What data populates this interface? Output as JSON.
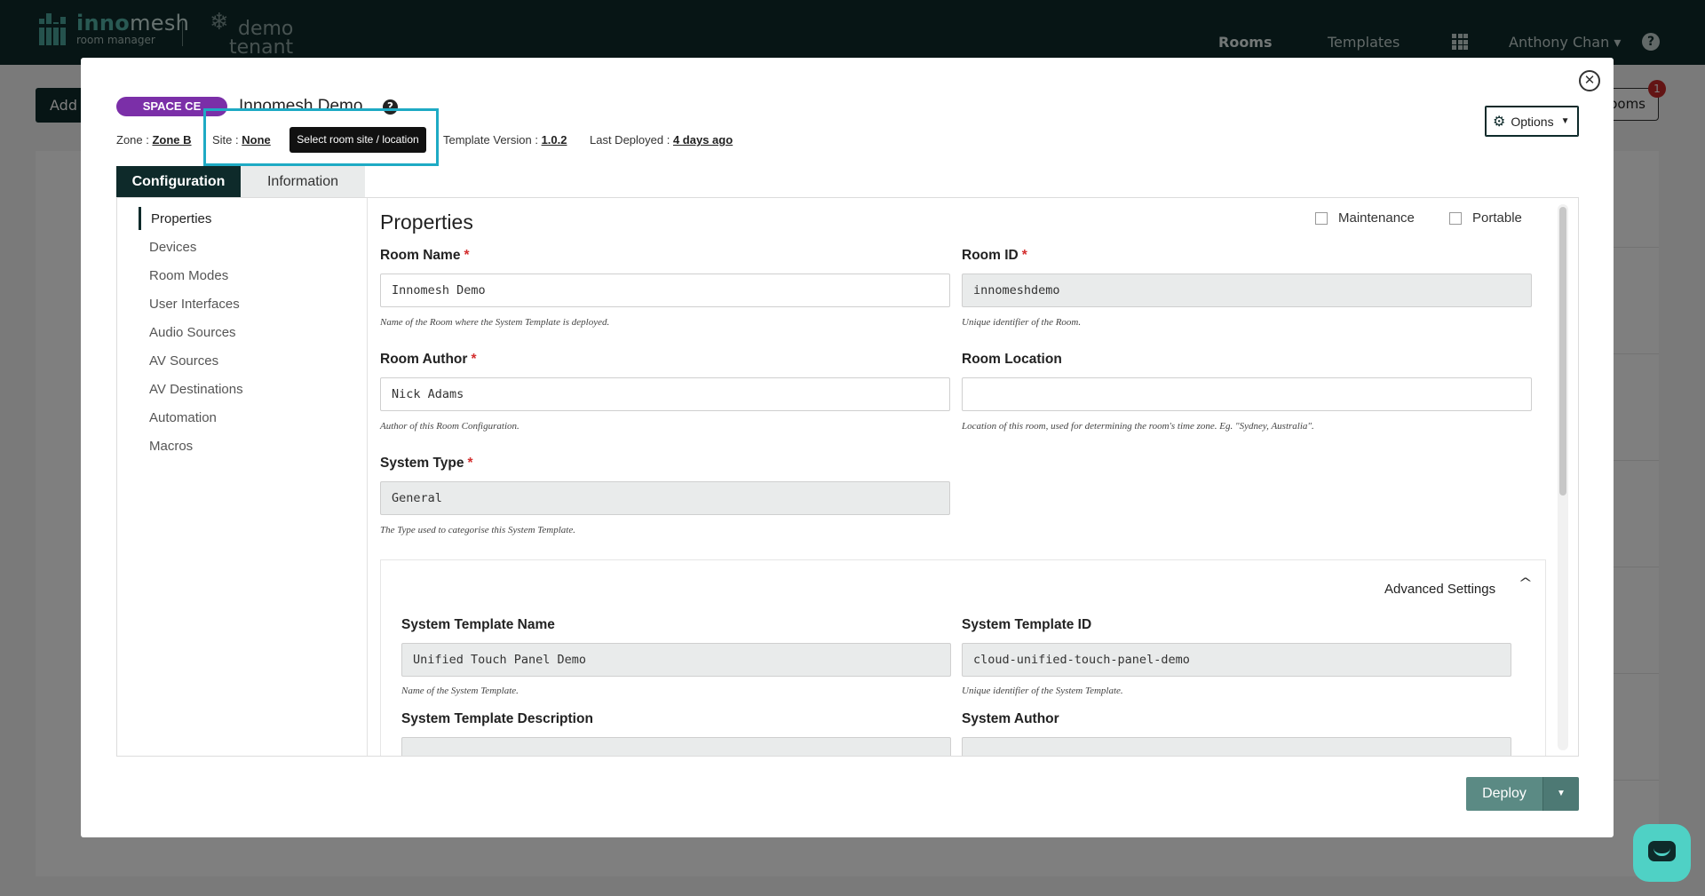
{
  "app": {
    "logo_name_a": "inno",
    "logo_name_b": "mesh",
    "logo_sub": "room manager",
    "tenant_line1": "demo",
    "tenant_line2": "tenant",
    "nav": {
      "rooms": "Rooms",
      "templates": "Templates",
      "user": "Anthony Chan ▾",
      "help": "?"
    },
    "add_button": "Add",
    "rooms_button": "ooms",
    "notification_count": "1"
  },
  "modal": {
    "badge": "SPACE CE",
    "room_title": "Innomesh Demo",
    "meta": {
      "zone_label": "Zone :",
      "zone_value": "Zone B",
      "site_label": "Site :",
      "site_value": "None",
      "site_tooltip": "Select room site / location",
      "version_label": "Template Version :",
      "version_value": "1.0.2",
      "deployed_label": "Last Deployed :",
      "deployed_value": "4 days ago"
    },
    "options_label": "Options",
    "tabs": [
      {
        "label": "Configuration"
      },
      {
        "label": "Information"
      }
    ],
    "sidebar": [
      {
        "label": "Properties"
      },
      {
        "label": "Devices"
      },
      {
        "label": "Room Modes"
      },
      {
        "label": "User Interfaces"
      },
      {
        "label": "Audio Sources"
      },
      {
        "label": "AV Sources"
      },
      {
        "label": "AV Destinations"
      },
      {
        "label": "Automation"
      },
      {
        "label": "Macros"
      }
    ],
    "properties": {
      "title": "Properties",
      "maintenance_label": "Maintenance",
      "portable_label": "Portable",
      "room_name": {
        "label": "Room Name",
        "value": "Innomesh Demo",
        "help": "Name of the Room where the System Template is deployed."
      },
      "room_id": {
        "label": "Room ID",
        "value": "innomeshdemo",
        "help": "Unique identifier of the Room."
      },
      "room_author": {
        "label": "Room Author",
        "value": "Nick Adams",
        "help": "Author of this Room Configuration."
      },
      "room_location": {
        "label": "Room Location",
        "value": "",
        "help": "Location of this room, used for determining the room's time zone. Eg. \"Sydney, Australia\"."
      },
      "system_type": {
        "label": "System Type",
        "value": "General",
        "help": "The Type used to categorise this System Template."
      },
      "advanced": {
        "toggle_label": "Advanced Settings",
        "template_name": {
          "label": "System Template Name",
          "value": "Unified Touch Panel Demo",
          "help": "Name of the System Template."
        },
        "template_id": {
          "label": "System Template ID",
          "value": "cloud-unified-touch-panel-demo",
          "help": "Unique identifier of the System Template."
        },
        "template_description": {
          "label": "System Template Description"
        },
        "system_author": {
          "label": "System Author"
        }
      }
    },
    "deploy_label": "Deploy"
  }
}
